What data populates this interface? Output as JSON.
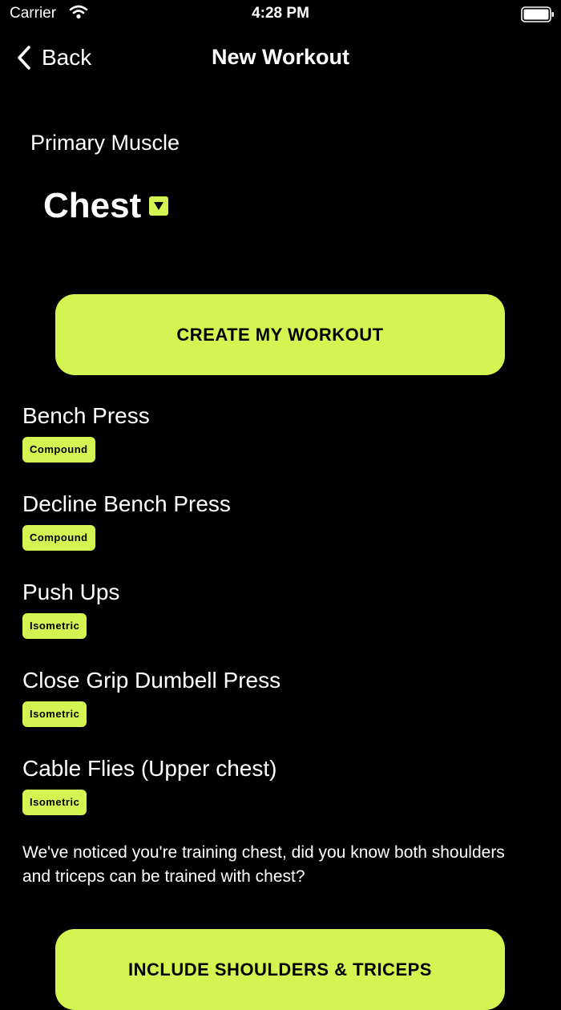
{
  "status_bar": {
    "carrier": "Carrier",
    "time": "4:28 PM"
  },
  "nav": {
    "back_label": "Back",
    "title": "New Workout"
  },
  "primary_muscle": {
    "label": "Primary Muscle",
    "value": "Chest"
  },
  "create_button": {
    "label": "CREATE MY WORKOUT"
  },
  "exercises": [
    {
      "name": "Bench Press",
      "tag": "Compound"
    },
    {
      "name": "Decline Bench Press",
      "tag": "Compound"
    },
    {
      "name": "Push Ups",
      "tag": "Isometric"
    },
    {
      "name": "Close Grip Dumbell Press",
      "tag": "Isometric"
    },
    {
      "name": "Cable Flies (Upper chest)",
      "tag": "Isometric"
    }
  ],
  "suggestion": {
    "text": "We've noticed you're training chest, did you know both shoulders and triceps can be trained with chest?"
  },
  "include_button": {
    "label": "INCLUDE SHOULDERS & TRICEPS"
  },
  "colors": {
    "accent": "#d4f551",
    "background": "#000000",
    "text": "#ffffff"
  }
}
